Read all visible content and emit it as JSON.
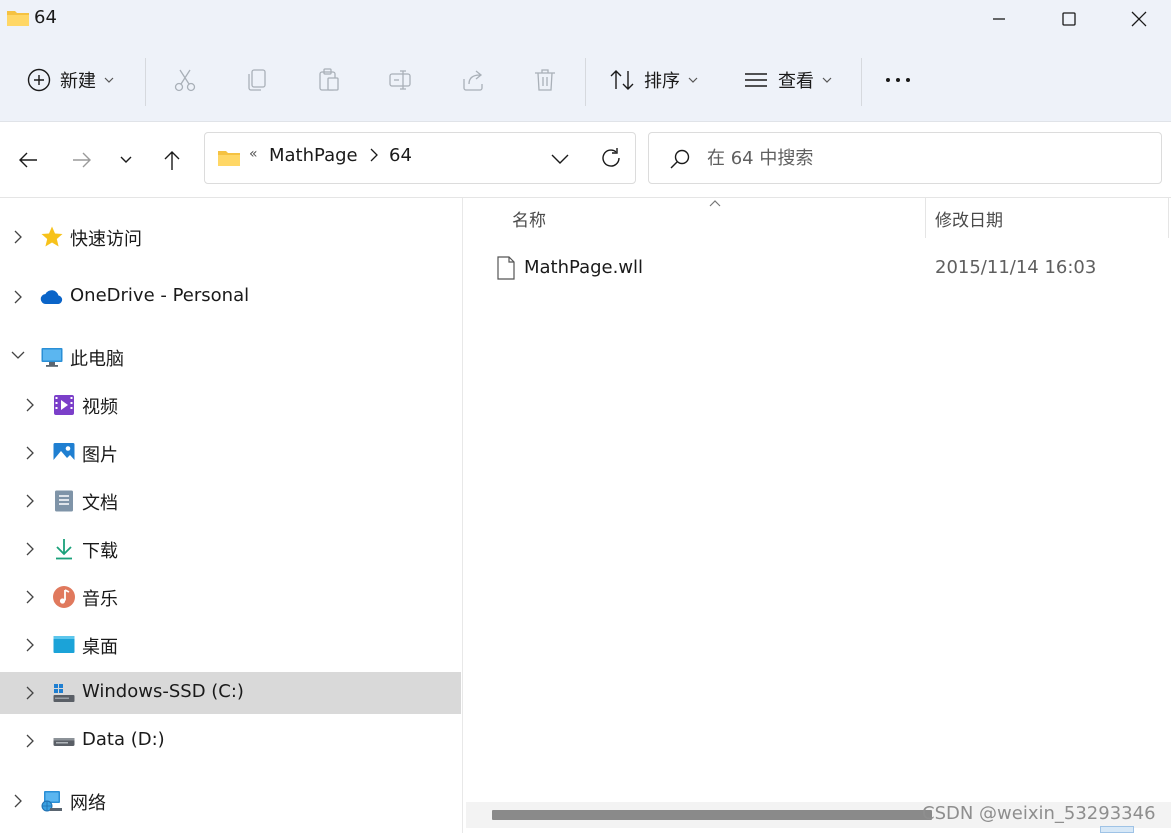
{
  "window": {
    "title": "64",
    "minimize_label": "minimize",
    "maximize_label": "maximize",
    "close_label": "close"
  },
  "toolbar": {
    "new_label": "新建",
    "sort_label": "排序",
    "view_label": "查看"
  },
  "address": {
    "overflow": "«",
    "crumbs": [
      "MathPage",
      "64"
    ]
  },
  "search": {
    "placeholder": "在 64 中搜索"
  },
  "sidebar": {
    "items": [
      {
        "label": "快速访问"
      },
      {
        "label": "OneDrive - Personal"
      },
      {
        "label": "此电脑"
      },
      {
        "label": "视频"
      },
      {
        "label": "图片"
      },
      {
        "label": "文档"
      },
      {
        "label": "下载"
      },
      {
        "label": "音乐"
      },
      {
        "label": "桌面"
      },
      {
        "label": "Windows-SSD (C:)"
      },
      {
        "label": "Data (D:)"
      },
      {
        "label": "网络"
      }
    ]
  },
  "content": {
    "columns": [
      "名称",
      "修改日期"
    ],
    "files": [
      {
        "name": "MathPage.wll",
        "modified": "2015/11/14 16:03"
      }
    ]
  },
  "watermark": "CSDN @weixin_53293346",
  "colors": {
    "chrome_bg": "#eef2f9",
    "selected_bg": "#d9d9d9",
    "folder_yellow": "#f5c242",
    "accent_blue": "#0a64c8"
  }
}
